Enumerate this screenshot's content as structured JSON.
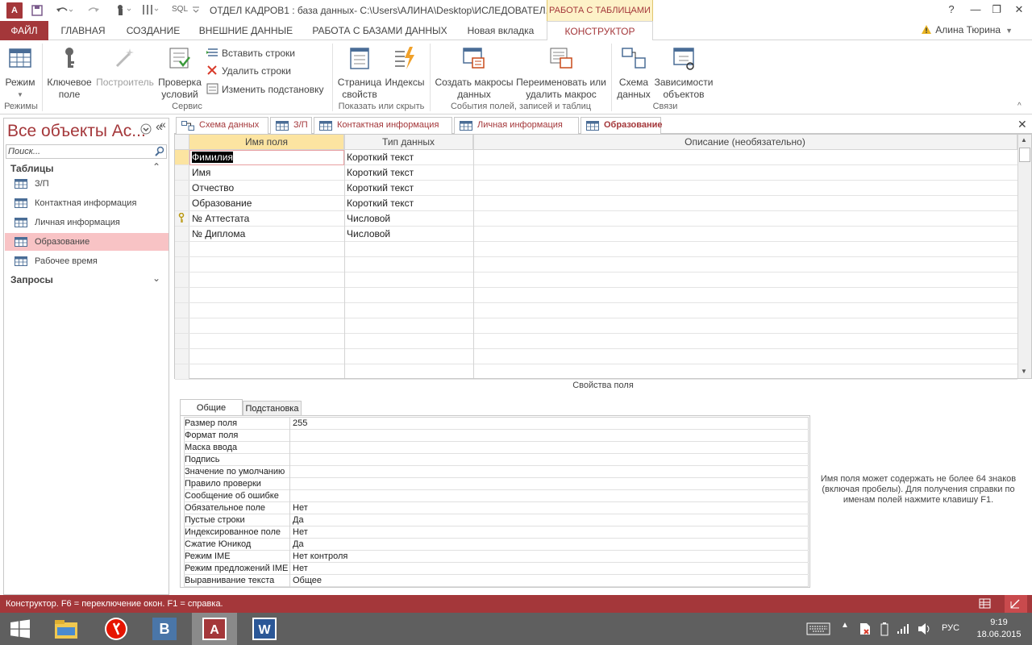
{
  "titlebar": {
    "app_icon": "A",
    "title": "ОТДЕЛ КАДРОВ1 : база данных- C:\\Users\\АЛИНА\\Desktop\\ИСЛЕДОВАТЕЛ...",
    "context_group": "РАБОТА С ТАБЛИЦАМИ",
    "help": "?",
    "minimize": "—",
    "restore": "❐",
    "close": "✕",
    "qat": [
      "save-icon",
      "undo-icon",
      "redo-icon",
      "touch-mode-icon",
      "customize-icon"
    ],
    "qat_sql": "SQL"
  },
  "tabs": {
    "file": "ФАЙЛ",
    "home": "ГЛАВНАЯ",
    "create": "СОЗДАНИЕ",
    "external": "ВНЕШНИЕ ДАННЫЕ",
    "dbtools": "РАБОТА С БАЗАМИ ДАННЫХ",
    "newtab": "Новая вкладка",
    "designer": "КОНСТРУКТОР"
  },
  "user": {
    "name": "Алина Тюрина",
    "warning_icon": "warning-icon"
  },
  "ribbon": {
    "view": "Режим",
    "primary_key": "Ключевое поле",
    "builder": "Построитель",
    "test_rules": "Проверка условий",
    "insert_rows": "Вставить строки",
    "delete_rows": "Удалить строки",
    "modify_lookup": "Изменить подстановку",
    "property_sheet": "Страница свойств",
    "indexes": "Индексы",
    "create_macros": "Создать макросы данных",
    "rename_macro": "Переименовать или удалить макрос",
    "relationships": "Схема данных",
    "dependencies": "Зависимости объектов",
    "groups": {
      "views": "Режимы",
      "tools": "Сервис",
      "show_hide": "Показать или скрыть",
      "events": "События полей, записей и таблиц",
      "relations": "Связи"
    }
  },
  "nav": {
    "title": "Все объекты Ac...",
    "search_placeholder": "Поиск...",
    "group_tables": "Таблицы",
    "group_queries": "Запросы",
    "items": [
      "З/П",
      "Контактная информация",
      "Личная информация",
      "Образование",
      "Рабочее время"
    ],
    "selected_index": 3
  },
  "doctabs": [
    "Схема данных",
    "З/П",
    "Контактная информация",
    "Личная информация",
    "Образование"
  ],
  "doctabs_active": 4,
  "grid": {
    "headers": [
      "Имя поля",
      "Тип данных",
      "Описание (необязательно)"
    ],
    "rows": [
      {
        "name": "Фимилия",
        "type": "Короткий текст",
        "key": false
      },
      {
        "name": "Имя",
        "type": "Короткий текст",
        "key": false
      },
      {
        "name": "Отчество",
        "type": "Короткий текст",
        "key": false
      },
      {
        "name": "Образование",
        "type": "Короткий текст",
        "key": false
      },
      {
        "name": "№ Аттестата",
        "type": "Числовой",
        "key": true
      },
      {
        "name": "№ Диплома",
        "type": "Числовой",
        "key": false
      }
    ],
    "empty_rows": 9
  },
  "props": {
    "label": "Свойства поля",
    "tab_general": "Общие",
    "tab_lookup": "Подстановка",
    "rows": [
      {
        "name": "Размер поля",
        "value": "255"
      },
      {
        "name": "Формат поля",
        "value": ""
      },
      {
        "name": "Маска ввода",
        "value": ""
      },
      {
        "name": "Подпись",
        "value": ""
      },
      {
        "name": "Значение по умолчанию",
        "value": ""
      },
      {
        "name": "Правило проверки",
        "value": ""
      },
      {
        "name": "Сообщение об ошибке",
        "value": ""
      },
      {
        "name": "Обязательное поле",
        "value": "Нет"
      },
      {
        "name": "Пустые строки",
        "value": "Да"
      },
      {
        "name": "Индексированное поле",
        "value": "Нет"
      },
      {
        "name": "Сжатие Юникод",
        "value": "Да"
      },
      {
        "name": "Режим IME",
        "value": "Нет контроля"
      },
      {
        "name": "Режим предложений IME",
        "value": "Нет"
      },
      {
        "name": "Выравнивание текста",
        "value": "Общее"
      }
    ],
    "help": "Имя поля может содержать не более 64 знаков (включая пробелы). Для получения справки по именам полей нажмите клавишу F1."
  },
  "status": {
    "text": "Конструктор.  F6 = переключение окон.  F1 = справка."
  },
  "taskbar": {
    "lang": "РУС",
    "time": "9:19",
    "date": "18.06.2015",
    "apps": [
      "start-icon",
      "explorer-icon",
      "yandex-icon",
      "vk-icon",
      "access-icon",
      "word-icon"
    ]
  },
  "colors": {
    "accent": "#a4373a",
    "selected": "#f8c3c5",
    "context": "#fdf2c8"
  }
}
